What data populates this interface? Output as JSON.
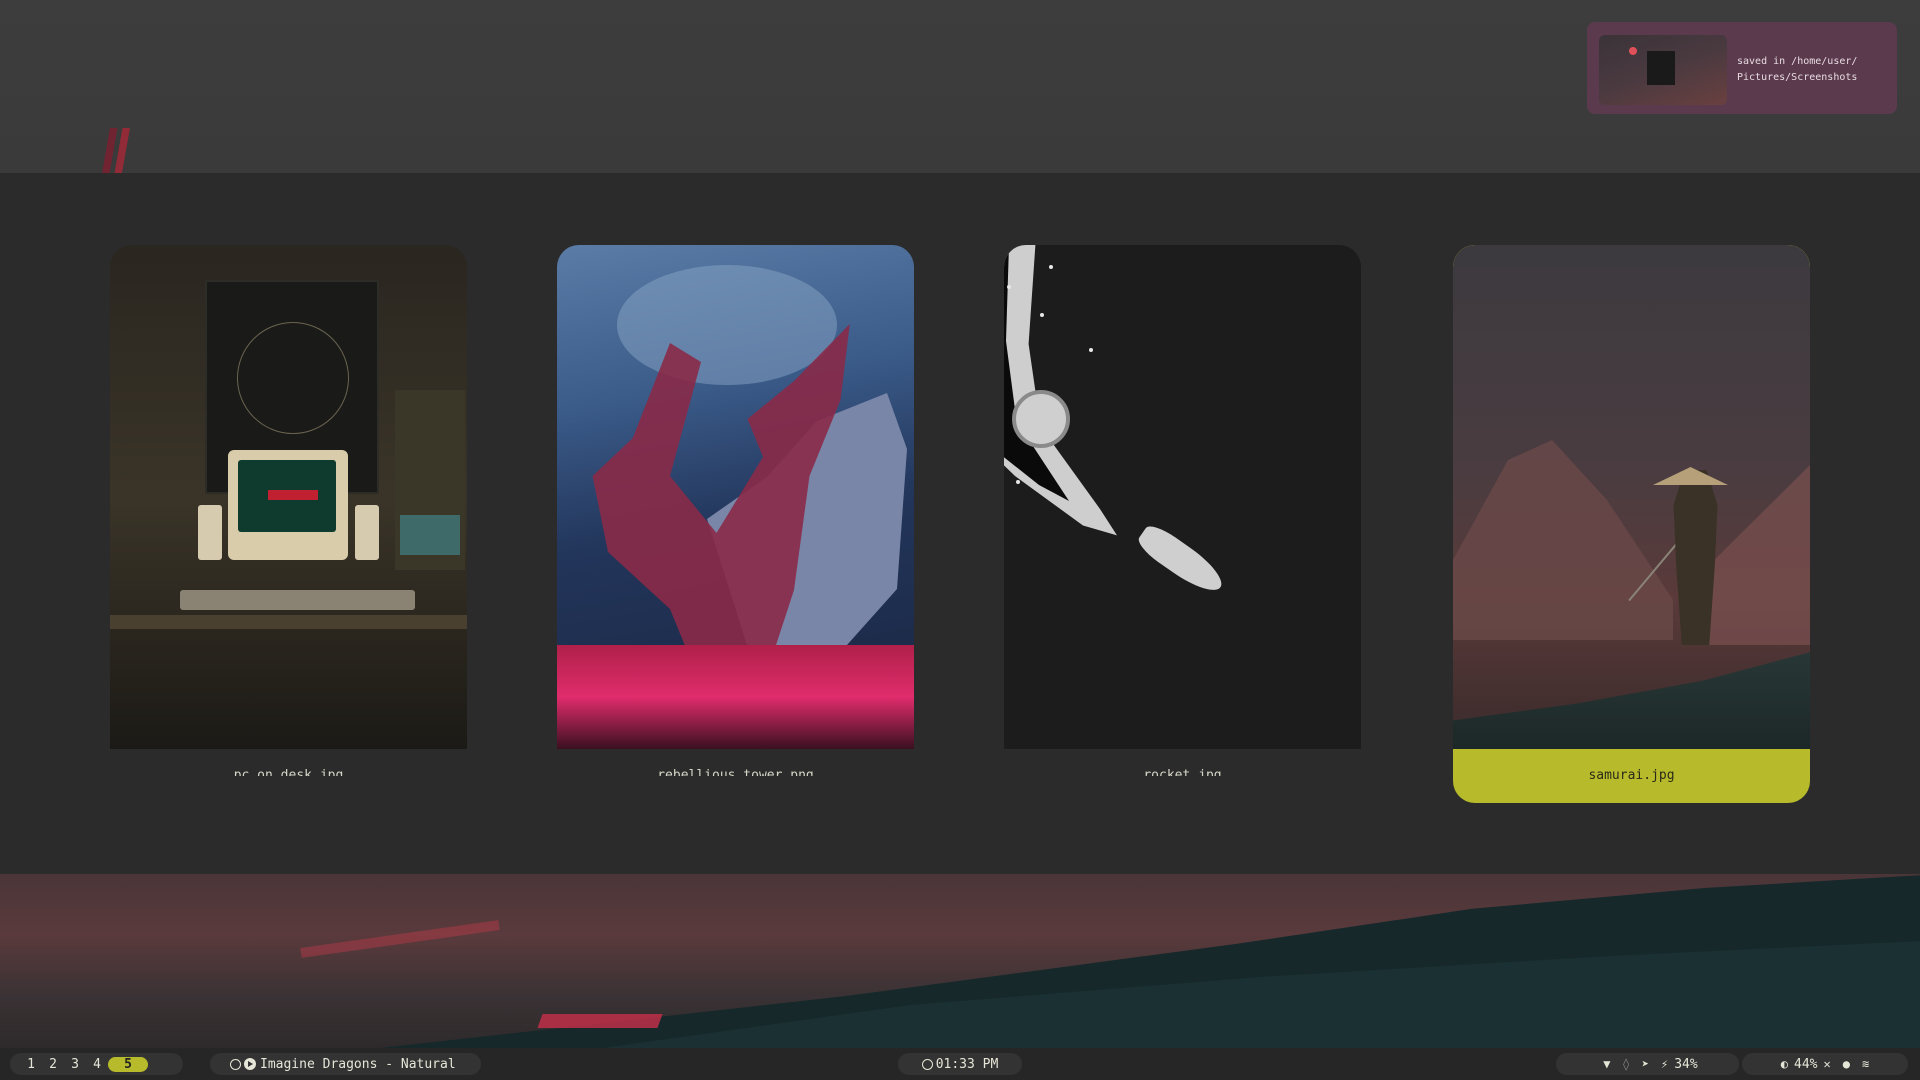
{
  "notification": {
    "line1": "saved in /home/user/",
    "line2": "Pictures/Screenshots"
  },
  "launcher": {
    "items": [
      {
        "label": "pc_on_desk.jpg",
        "selected": false
      },
      {
        "label": "rebellious_tower.png",
        "selected": false
      },
      {
        "label": "rocket.jpg",
        "selected": false
      },
      {
        "label": "samurai.jpg",
        "selected": true
      }
    ]
  },
  "taskbar": {
    "workspaces": [
      "1",
      "2",
      "3",
      "4",
      "5"
    ],
    "active_workspace": "5",
    "media": "Imagine Dragons - Natural",
    "clock": "01:33 PM",
    "battery": "34%",
    "brightness": "44%"
  },
  "colors": {
    "accent": "#b7bb2b",
    "panel": "#2b2b2b",
    "notification_bg": "#5b3a4e",
    "taskbar_bg": "#262626"
  }
}
